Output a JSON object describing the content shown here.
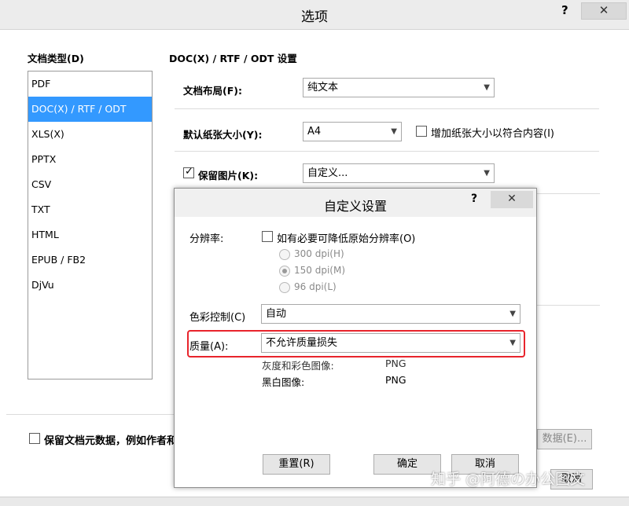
{
  "window": {
    "title": "选项",
    "help": "?",
    "close": "✕"
  },
  "sidebar": {
    "header": "文档类型(D)",
    "items": [
      "PDF",
      "DOC(X) / RTF / ODT",
      "XLS(X)",
      "PPTX",
      "CSV",
      "TXT",
      "HTML",
      "EPUB / FB2",
      "DjVu"
    ],
    "selected_index": 1
  },
  "settings": {
    "header": "DOC(X) / RTF / ODT 设置",
    "layout_label": "文档布局(F):",
    "layout_value": "纯文本",
    "paper_label": "默认纸张大小(Y):",
    "paper_value": "A4",
    "enlarge_label": "增加纸张大小以符合内容(I)",
    "keep_images_label": "保留图片(K):",
    "keep_images_value": "自定义..."
  },
  "footer": {
    "keep_meta_label": "保留文档元数据，例如作者和",
    "meta_button": "数据(E)...",
    "ok_button_partial": "取消"
  },
  "modal": {
    "title": "自定义设置",
    "help": "?",
    "close": "✕",
    "resolution_label": "分辨率:",
    "reduce_label": "如有必要可降低原始分辨率(O)",
    "dpi_options": [
      "300 dpi(H)",
      "150 dpi(M)",
      "96 dpi(L)"
    ],
    "dpi_selected_index": 1,
    "color_label": "色彩控制(C)",
    "color_value": "自动",
    "quality_label": "质量(A):",
    "quality_value": "不允许质量损失",
    "gray_label": "灰度和彩色图像:",
    "gray_value": "PNG",
    "bw_label": "黑白图像:",
    "bw_value": "PNG",
    "reset_button": "重置(R)",
    "ok_button": "确定",
    "cancel_button": "取消"
  },
  "watermark": "知乎 @阿德の办公图文",
  "colors": {
    "selection": "#3399ff",
    "highlight_border": "#e8242c"
  }
}
